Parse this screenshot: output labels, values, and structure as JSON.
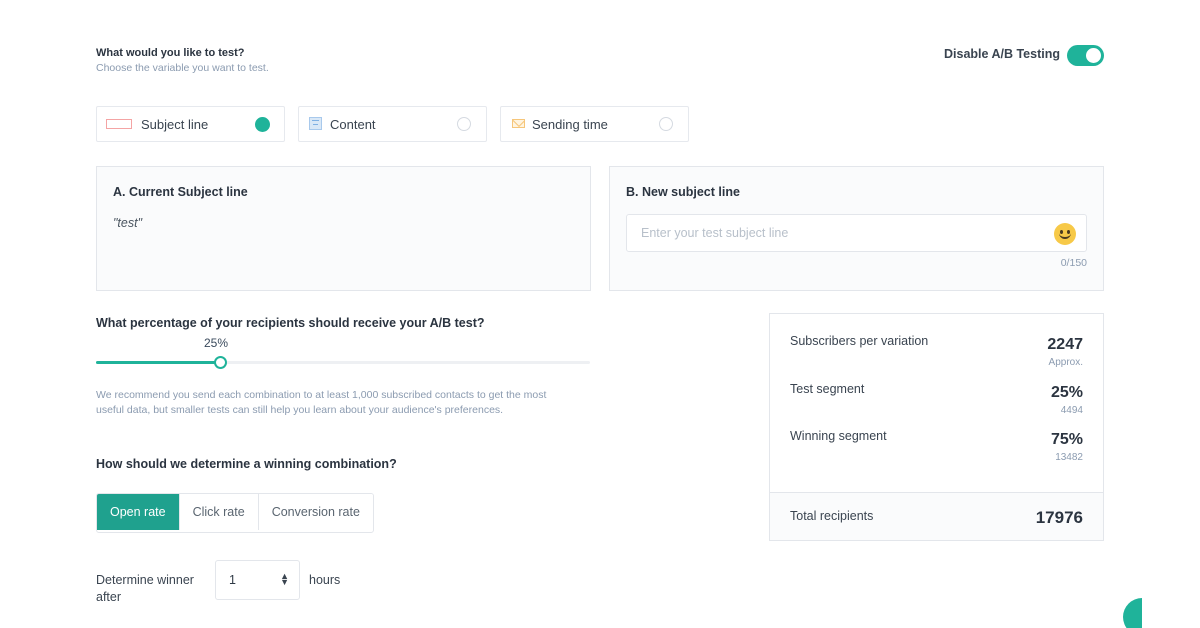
{
  "header": {
    "title": "What would you like to test?",
    "subtitle": "Choose the variable you want to test.",
    "toggle_label": "Disable A/B Testing",
    "toggle_on": true
  },
  "test_options": [
    {
      "label": "Subject line",
      "icon": "subject-line-icon",
      "selected": true
    },
    {
      "label": "Content",
      "icon": "content-icon",
      "selected": false
    },
    {
      "label": "Sending time",
      "icon": "envelope-icon",
      "selected": false
    }
  ],
  "panel_a": {
    "title": "A. Current Subject line",
    "value": "\"test\""
  },
  "panel_b": {
    "title": "B. New subject line",
    "placeholder": "Enter your test subject line",
    "value": "",
    "counter": "0/150",
    "emoji_icon": "smiley-icon"
  },
  "percentage": {
    "question": "What percentage of your recipients should receive your A/B test?",
    "value_label": "25%",
    "value": 25,
    "min": 0,
    "max": 100,
    "recommendation": "We recommend you send each combination to at least 1,000 subscribed contacts to get the most useful data, but smaller tests can still help you learn about your audience's preferences."
  },
  "winning": {
    "question": "How should we determine a winning combination?",
    "options": [
      {
        "label": "Open rate",
        "active": true
      },
      {
        "label": "Click rate",
        "active": false
      },
      {
        "label": "Conversion rate",
        "active": false
      }
    ]
  },
  "determine": {
    "label": "Determine winner after",
    "value": "1",
    "unit": "hours"
  },
  "stats": {
    "subscribers_label": "Subscribers per variation",
    "subscribers_value": "2247",
    "subscribers_note": "Approx.",
    "test_label": "Test segment",
    "test_value": "25%",
    "test_count": "4494",
    "winning_label": "Winning segment",
    "winning_value": "75%",
    "winning_count": "13482",
    "total_label": "Total recipients",
    "total_value": "17976"
  },
  "colors": {
    "accent": "#1fb39a",
    "accent_dark": "#1fa18e"
  }
}
